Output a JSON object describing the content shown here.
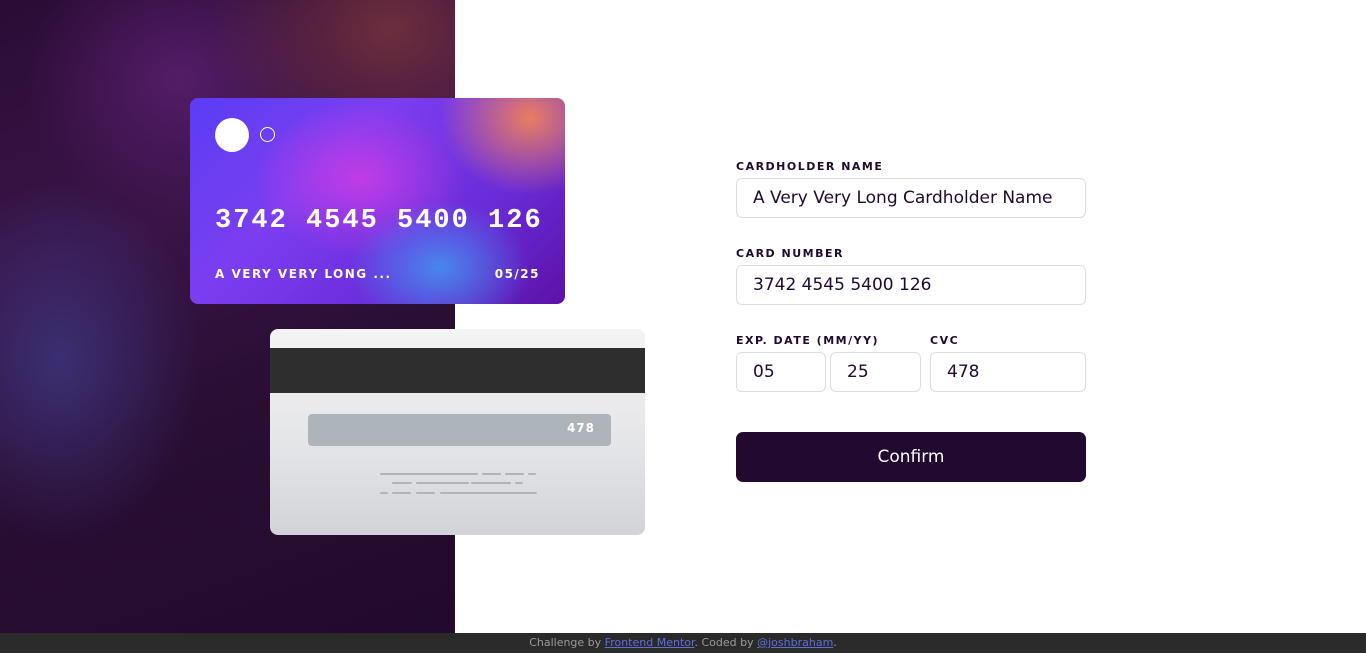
{
  "card_front": {
    "number": "3742 4545 5400 126",
    "name": "A VERY VERY LONG ...",
    "expiry": "05/25"
  },
  "card_back": {
    "cvc": "478"
  },
  "form": {
    "name_label": "CARDHOLDER NAME",
    "name_value": "A Very Very Long Cardholder Name",
    "number_label": "CARD NUMBER",
    "number_value": "3742 4545 5400 126",
    "exp_label": "EXP. DATE (MM/YY)",
    "exp_month_value": "05",
    "exp_year_value": "25",
    "cvc_label": "CVC",
    "cvc_value": "478",
    "confirm_label": "Confirm"
  },
  "footer": {
    "prefix": "Challenge by ",
    "link1": "Frontend Mentor",
    "middle": ". Coded by ",
    "link2": "@joshbraham",
    "suffix": "."
  },
  "colors": {
    "accent_dark": "#21092f",
    "link": "#5c6ee0"
  }
}
